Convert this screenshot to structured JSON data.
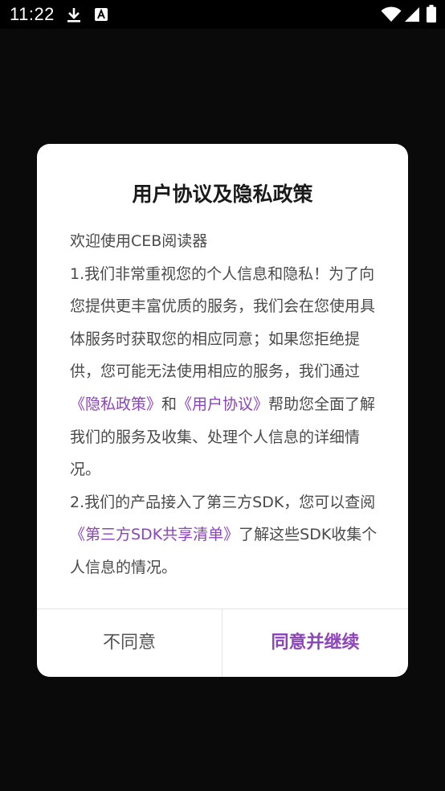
{
  "status_bar": {
    "time": "11:22",
    "icons": [
      "download-icon",
      "text-a-icon",
      "wifi-icon",
      "signal-icon",
      "battery-icon"
    ]
  },
  "dialog": {
    "title": "用户协议及隐私政策",
    "welcome": "欢迎使用CEB阅读器",
    "p1_a": "1.我们非常重视您的个人信息和隐私！为了向您提供更丰富优质的服务，我们会在您使用具体服务时获取您的相应同意；如果您拒绝提供，您可能无法使用相应的服务，我们通过",
    "privacy_link": "《隐私政策》",
    "p1_and": "和",
    "user_agreement_link": "《用户协议》",
    "p1_b": "帮助您全面了解我们的服务及收集、处理个人信息的详细情况。",
    "p2_a": "2.我们的产品接入了第三方SDK，您可以查阅",
    "sdk_link": "《第三方SDK共享清单》",
    "p2_b": "了解这些SDK收集个人信息的情况。",
    "disagree_label": "不同意",
    "agree_label": "同意并继续"
  },
  "colors": {
    "accent": "#8a45b8",
    "background": "#0a0a0a",
    "dialog_bg": "#ffffff"
  }
}
